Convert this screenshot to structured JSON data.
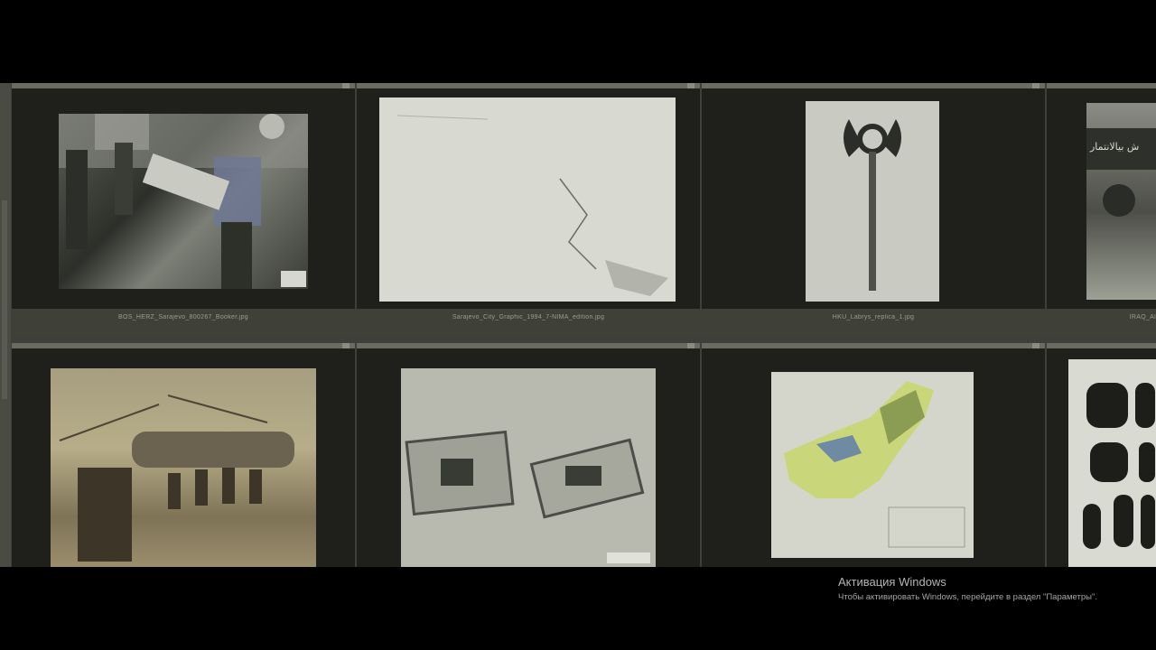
{
  "gallery": {
    "row1": [
      {
        "caption": "BOS_HERZ_Sarajevo_800267_Booker.jpg",
        "icon": "photo-soldiers-stretcher"
      },
      {
        "caption": "Sarajevo_City_Graphic_1994_7-NIMA_edition.jpg",
        "icon": "map-graphic"
      },
      {
        "caption": "HKU_Labrys_replica_1.jpg",
        "icon": "labrys-axe"
      },
      {
        "caption": "IRAQ_Al",
        "icon": "photo-truck-arabic-banner"
      }
    ],
    "row2": [
      {
        "caption": "",
        "icon": "photo-helicopter-soldiers"
      },
      {
        "caption": "",
        "icon": "satellite-compound"
      },
      {
        "caption": "",
        "icon": "map-afghanistan"
      },
      {
        "caption": "",
        "icon": "fingerprints-sheet"
      }
    ],
    "iraq_banner_text": "ش بيالانتمار"
  },
  "activation": {
    "title": "Активация Windows",
    "text": "Чтобы активировать Windows, перейдите в раздел \"Параметры\"."
  },
  "colors": {
    "background": "#000000",
    "panel": "#3d3f38",
    "cell": "#1f201c"
  }
}
